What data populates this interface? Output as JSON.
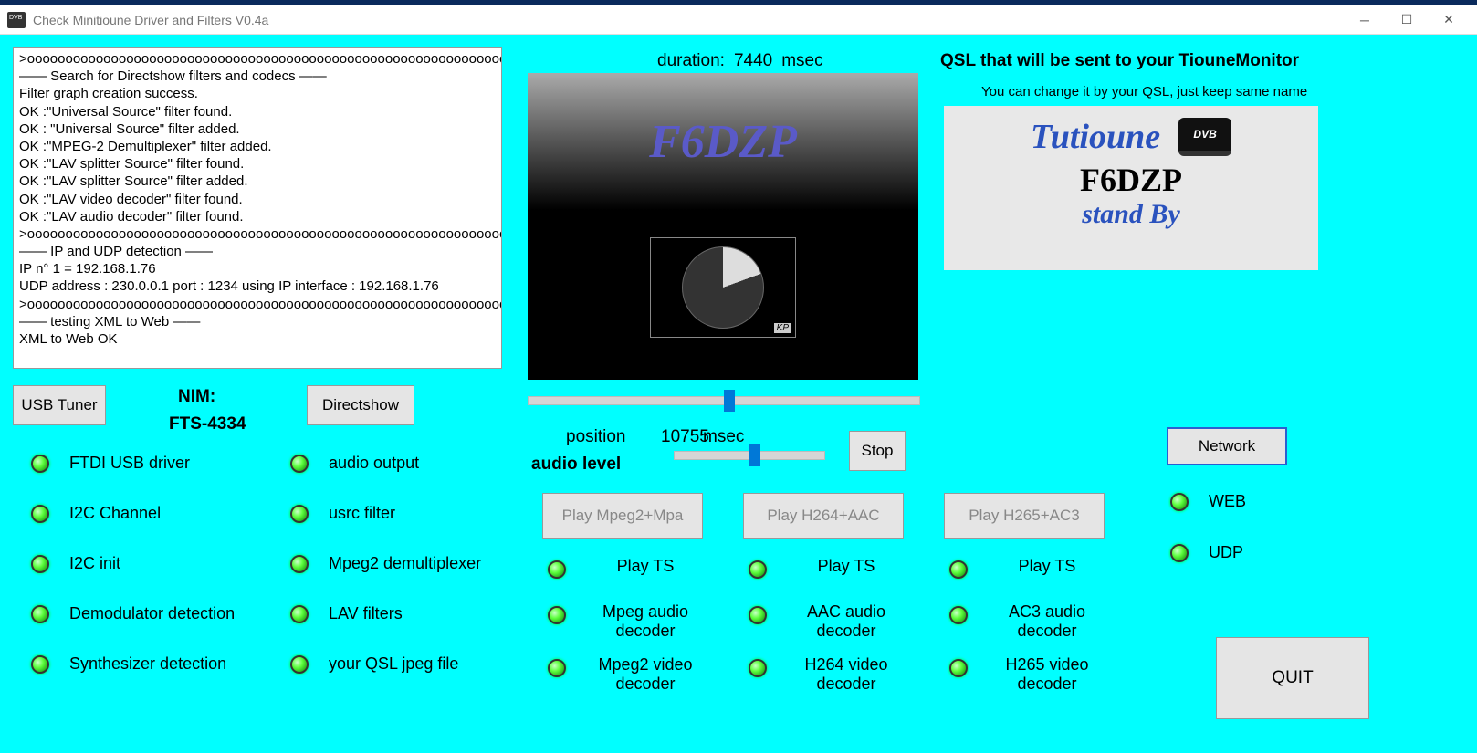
{
  "window": {
    "title": "Check Minitioune Driver and Filters V0.4a"
  },
  "log": {
    "lines": [
      ">ooooooooooooooooooooooooooooooooooooooooooooooooooooooooooooooooooooooooooooooo",
      "—— Search for Directshow filters and codecs ——",
      "Filter graph creation success.",
      "OK :\"Universal Source\" filter found.",
      "OK : \"Universal Source\" filter added.",
      "OK :\"MPEG-2 Demultiplexer\" filter added.",
      "OK :\"LAV splitter Source\" filter found.",
      "OK :\"LAV splitter Source\" filter added.",
      "OK :\"LAV video decoder\" filter found.",
      "OK :\"LAV audio decoder\" filter found.",
      ">ooooooooooooooooooooooooooooooooooooooooooooooooooooooooooooooooooooooooooooooo",
      "—— IP and UDP detection ——",
      "IP n° 1 = 192.168.1.76",
      "UDP address : 230.0.0.1 port : 1234 using IP interface : 192.168.1.76",
      ">ooooooooooooooooooooooooooooooooooooooooooooooooooooooooooooooooooooooooooooooo",
      "—— testing XML to Web ——",
      "XML to Web OK"
    ]
  },
  "duration": {
    "label": "duration:",
    "value": "7440",
    "unit": "msec"
  },
  "video": {
    "overlay_text": "F6DZP",
    "badge": "KP"
  },
  "qsl": {
    "title": "QSL that will be sent to your TiouneMonitor",
    "subtitle": "You can change it by your QSL, just keep same name",
    "brand": "Tutioune",
    "dvb": "DVB",
    "callsign": "F6DZP",
    "standby": "stand By"
  },
  "buttons": {
    "usb_tuner": "USB Tuner",
    "directshow": "Directshow",
    "stop": "Stop",
    "network": "Network",
    "quit": "QUIT",
    "play_mpeg2": "Play Mpeg2+Mpa",
    "play_h264": "Play H264+AAC",
    "play_h265": "Play H265+AC3"
  },
  "nim": {
    "label": "NIM:",
    "value": "FTS-4334"
  },
  "position": {
    "label": "position",
    "value": "10755",
    "unit": "msec"
  },
  "audio_level": "audio level",
  "sliders": {
    "progress_pct": 50,
    "audio_pct": 50
  },
  "leds_left": [
    {
      "label": "FTDI USB driver"
    },
    {
      "label": "I2C Channel"
    },
    {
      "label": "I2C init"
    },
    {
      "label": "Demodulator detection"
    },
    {
      "label": "Synthesizer detection"
    }
  ],
  "leds_mid": [
    {
      "label": "audio output"
    },
    {
      "label": "usrc filter"
    },
    {
      "label": "Mpeg2 demultiplexer"
    },
    {
      "label": "LAV filters"
    },
    {
      "label": "your QSL jpeg file"
    }
  ],
  "play_cols": [
    {
      "ts": "Play TS",
      "audio": "Mpeg audio decoder",
      "video": "Mpeg2 video decoder"
    },
    {
      "ts": "Play TS",
      "audio": "AAC audio decoder",
      "video": "H264 video decoder"
    },
    {
      "ts": "Play TS",
      "audio": "AC3 audio decoder",
      "video": "H265 video decoder"
    }
  ],
  "net_leds": [
    {
      "label": "WEB"
    },
    {
      "label": "UDP"
    }
  ]
}
